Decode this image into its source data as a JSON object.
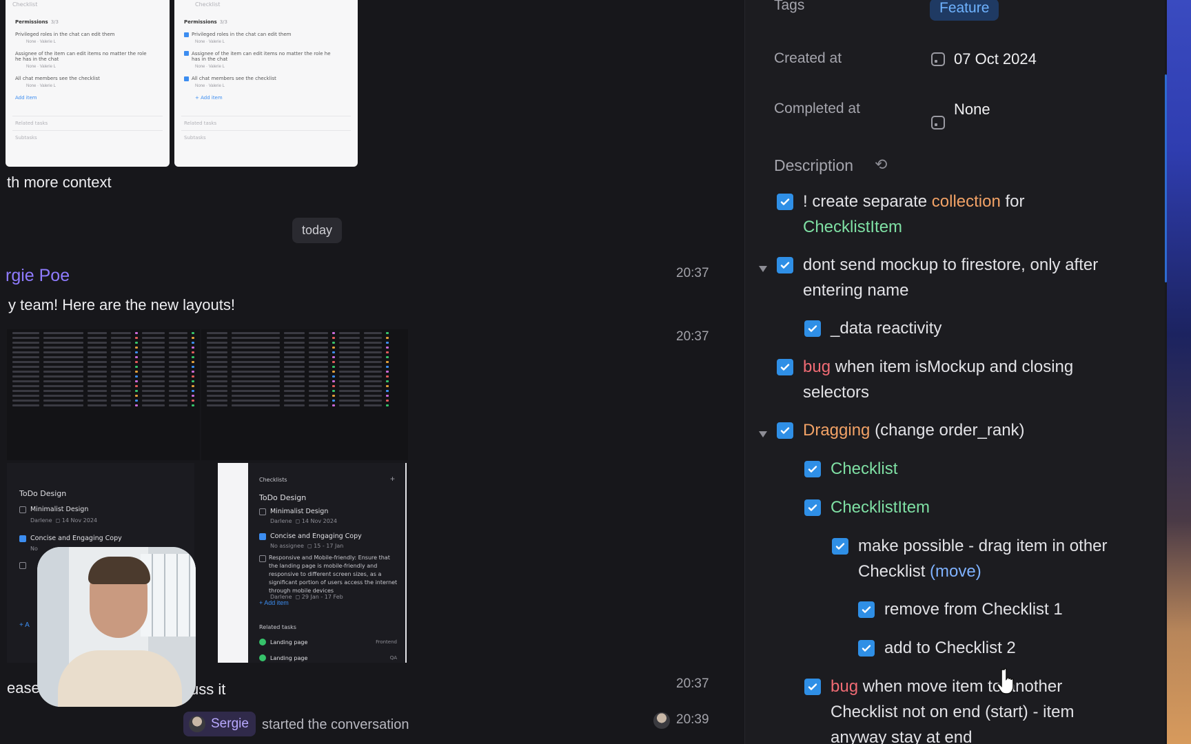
{
  "chat": {
    "top_thumbs": {
      "left": {
        "checklist": "Checklist",
        "permissions": "Permissions",
        "perm_count": "3/3",
        "items": [
          "Privileged roles in the chat can edit them",
          "Assignee of the item can edit items no matter the role he has in the chat",
          "All chat members see the checklist"
        ],
        "meta_none": "None",
        "meta_user": "Valerie L",
        "add_item": "Add item",
        "related": "Related tasks",
        "subtasks": "Subtasks"
      },
      "right": {
        "checklist": "Checklist",
        "permissions": "Permissions",
        "perm_count": "3/3",
        "items": [
          "Privileged roles in the chat can edit them",
          "Assignee of the item can edit items no matter the role he has in the chat",
          "All chat members see the checklist"
        ],
        "meta_none": "None",
        "meta_user": "Valerie L",
        "add_item": "+ Add item",
        "related": "Related tasks",
        "subtasks": "Subtasks"
      }
    },
    "caption_1": "th more context",
    "date_divider": "today",
    "sender_name": "rgie Poe",
    "message_1": "y team! Here are the new layouts!",
    "time_1": "20:37",
    "time_2": "20:37",
    "bottom_left_panel": {
      "title": "ToDo Design",
      "item_1": "Minimalist Design",
      "item_1_meta_user": "Darlene",
      "item_1_meta_date": "14 Nov 2024",
      "item_2": "Concise and Engaging Copy",
      "item_2_meta": "No",
      "add_item": "+ A"
    },
    "bottom_right_panel": {
      "section": "Checklists",
      "title": "ToDo Design",
      "item_1": "Minimalist Design",
      "item_1_meta_user": "Darlene",
      "item_1_meta_date": "14 Nov 2024",
      "item_2": "Concise and Engaging Copy",
      "item_2_meta_assignee": "No assignee",
      "item_2_meta_date": "15 - 17 Jan",
      "item_3": "Responsive and Mobile-friendly: Ensure that the landing page is mobile-friendly and responsive to different screen sizes, as a significant portion of users access the internet through mobile devices",
      "item_3_meta_user": "Darlene",
      "item_3_meta_date": "29 Jan - 17 Feb",
      "add_item": "+ Add item",
      "related_title": "Related tasks",
      "related_1": "Landing page",
      "related_1_tag": "Frontend",
      "related_2": "Landing page",
      "related_2_tag": "QA"
    },
    "message_2_left": "ease",
    "message_2_right": "uss it",
    "time_3": "20:37",
    "system_user": "Sergie",
    "system_text": "started the conversation",
    "time_4": "20:39"
  },
  "detail": {
    "tags_label": "Tags",
    "tag_value": "Feature",
    "created_label": "Created at",
    "created_value": "07 Oct 2024",
    "completed_label": "Completed at",
    "completed_value": "None",
    "description_label": "Description",
    "items": {
      "i1_a": "! create separate ",
      "i1_b": "collection",
      "i1_c": " for",
      "i1_d": "ChecklistItem",
      "i2": "dont send mockup to firestore, only after entering name",
      "i3": "_data reactivity",
      "i4_a": "bug",
      "i4_b": " when item isMockup and closing selectors",
      "i5_a": "Dragging",
      "i5_b": " (change order_rank)",
      "i6": "Checklist",
      "i7": "ChecklistItem",
      "i8_a": "make possible - drag item in other Checklist ",
      "i8_b": "(move)",
      "i9": "remove from Checklist 1",
      "i10": "add to Checklist 2",
      "i11_a": "bug",
      "i11_b": " when move item to another Checklist not on end (start) - item anyway stay at end"
    }
  },
  "colors": {
    "accent_blue": "#2f8fe6",
    "orange": "#f2a266",
    "green": "#7fe0a4",
    "red": "#f06b74",
    "purple": "#8f7bff"
  }
}
